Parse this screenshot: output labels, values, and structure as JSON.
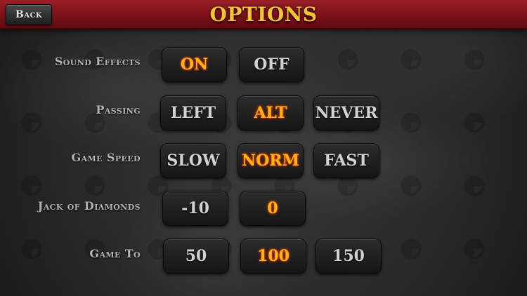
{
  "header": {
    "back_label": "Back",
    "title": "OPTIONS"
  },
  "rows": [
    {
      "label": "Sound Effects",
      "options": [
        "ON",
        "OFF"
      ],
      "selected": "ON"
    },
    {
      "label": "Passing",
      "options": [
        "LEFT",
        "ALT",
        "NEVER"
      ],
      "selected": "ALT"
    },
    {
      "label": "Game Speed",
      "options": [
        "SLOW",
        "NORM",
        "FAST"
      ],
      "selected": "NORM"
    },
    {
      "label": "Jack of Diamonds",
      "options": [
        "-10",
        "0"
      ],
      "selected": "0"
    },
    {
      "label": "Game To",
      "options": [
        "50",
        "100",
        "150"
      ],
      "selected": "100"
    }
  ],
  "colors": {
    "title": "#f3c33b",
    "header_red": "#7b1218",
    "selected_text": "#ffb21e",
    "unselected_text": "#d2d2d2",
    "label_text": "#b4b4b4"
  }
}
